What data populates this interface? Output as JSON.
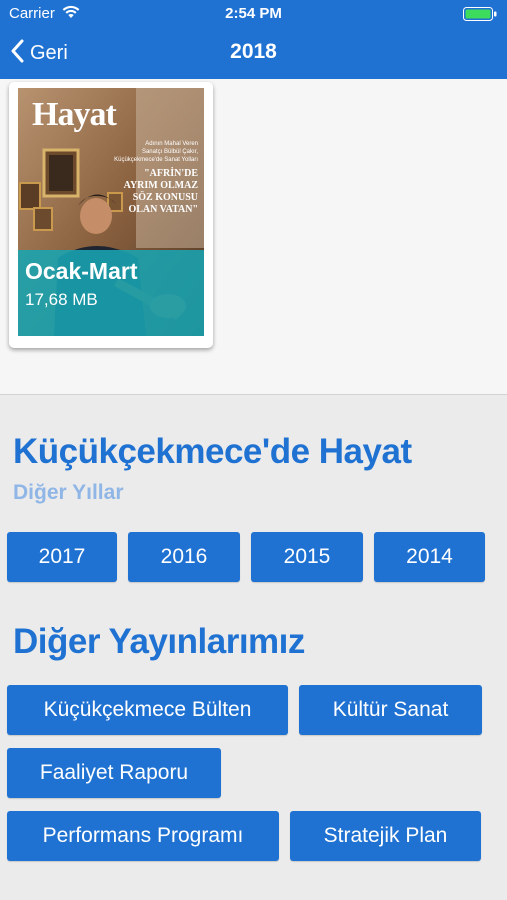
{
  "status_bar": {
    "carrier": "Carrier",
    "time": "2:54 PM"
  },
  "nav": {
    "back_label": "Geri",
    "title": "2018"
  },
  "issues": [
    {
      "title": "Ocak-Mart",
      "size": "17,68 MB",
      "cover": {
        "logo": "Hayat",
        "tagline_lines": [
          "Adının Mahal Veren",
          "Sanatçı Bülbül Çakır,",
          "Küçükçekmece'de Sanat Yolları"
        ],
        "headline_lines": [
          "\"AFRİN'DE",
          "AYRIM OLMAZ",
          "SÖZ KONUSU",
          "OLAN VATAN\""
        ]
      }
    }
  ],
  "magazine_section": {
    "heading": "Küçükçekmece'de Hayat",
    "subheading": "Diğer Yıllar"
  },
  "years": [
    "2017",
    "2016",
    "2015",
    "2014"
  ],
  "publications_section": {
    "heading": "Diğer Yayınlarımız"
  },
  "publications": [
    "Küçükçekmece Bülten",
    "Kültür Sanat",
    "Faaliyet Raporu",
    "Performans Programı",
    "Stratejik Plan"
  ],
  "colors": {
    "primary": "#1f72d2",
    "subheading": "#8fb6e6",
    "overlay": "#18a4b2",
    "background": "#ebebeb"
  }
}
